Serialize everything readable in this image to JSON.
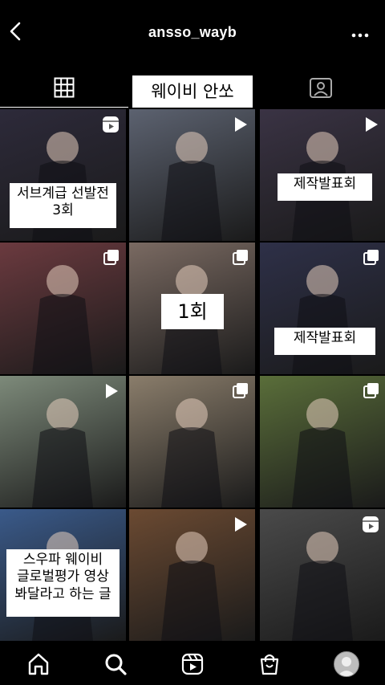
{
  "header": {
    "username": "ansso_wayb",
    "back_icon": "chevron-left-icon",
    "more_icon": "more-horizontal-icon"
  },
  "tabs": {
    "grid_icon": "grid-icon",
    "overlay_label": "웨이비 안쏘",
    "tagged_icon": "tagged-icon"
  },
  "posts": [
    {
      "caption": "서브계급 선발전\n3회",
      "badge": "reels-icon",
      "bg": "#2d2a3a"
    },
    {
      "caption": "",
      "badge": "play-icon",
      "bg": "#5c6270"
    },
    {
      "caption": "제작발표회",
      "badge": "play-icon",
      "bg": "#3a3344"
    },
    {
      "caption": "",
      "badge": "multiple-icon",
      "bg": "#6b3a3f"
    },
    {
      "caption": "1회",
      "badge": "multiple-icon",
      "bg": "#7a6a62"
    },
    {
      "caption": "제작발표회",
      "badge": "multiple-icon",
      "bg": "#2e3048"
    },
    {
      "caption": "",
      "badge": "play-icon",
      "bg": "#7d8a7a"
    },
    {
      "caption": "",
      "badge": "multiple-icon",
      "bg": "#8a7d6b"
    },
    {
      "caption": "",
      "badge": "multiple-icon",
      "bg": "#5a6e3a"
    },
    {
      "caption": "스우파 웨이비\n글로벌평가 영상\n봐달라고 하는 글",
      "badge": "",
      "bg": "#3a5a8a"
    },
    {
      "caption": "",
      "badge": "play-icon",
      "bg": "#6b4a32"
    },
    {
      "caption": "",
      "badge": "reels-icon",
      "bg": "#4a4a4a"
    }
  ],
  "bottom_nav": {
    "items": [
      "home-icon",
      "search-icon",
      "reels-icon",
      "shop-icon",
      "profile-avatar"
    ]
  }
}
